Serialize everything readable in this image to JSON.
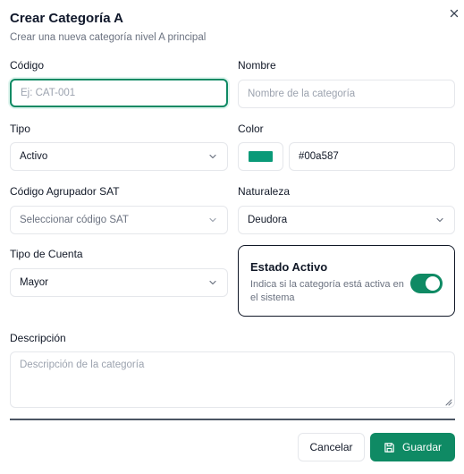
{
  "dialog": {
    "title": "Crear Categoría A",
    "subtitle": "Crear una nueva categoría nivel A principal"
  },
  "form": {
    "codigo": {
      "label": "Código",
      "placeholder": "Ej: CAT-001",
      "value": ""
    },
    "nombre": {
      "label": "Nombre",
      "placeholder": "Nombre de la categoría",
      "value": ""
    },
    "tipo": {
      "label": "Tipo",
      "selected": "Activo"
    },
    "color": {
      "label": "Color",
      "hex": "#00a587",
      "swatch": "#0a9a78"
    },
    "agrupador": {
      "label": "Código Agrupador SAT",
      "placeholder": "Seleccionar código SAT"
    },
    "naturaleza": {
      "label": "Naturaleza",
      "selected": "Deudora"
    },
    "tipo_cuenta": {
      "label": "Tipo de Cuenta",
      "selected": "Mayor"
    },
    "estado": {
      "title": "Estado Activo",
      "description": "Indica si la categoría está activa en el sistema",
      "enabled": true
    },
    "descripcion": {
      "label": "Descripción",
      "placeholder": "Descripción de la categoría",
      "value": ""
    }
  },
  "actions": {
    "cancel_label": "Cancelar",
    "save_label": "Guardar",
    "save_icon": "save-icon"
  },
  "colors": {
    "accent": "#0f8a64",
    "focus_ring": "#0f8a64",
    "muted_text": "#6b7280",
    "border": "#e5e7eb"
  }
}
